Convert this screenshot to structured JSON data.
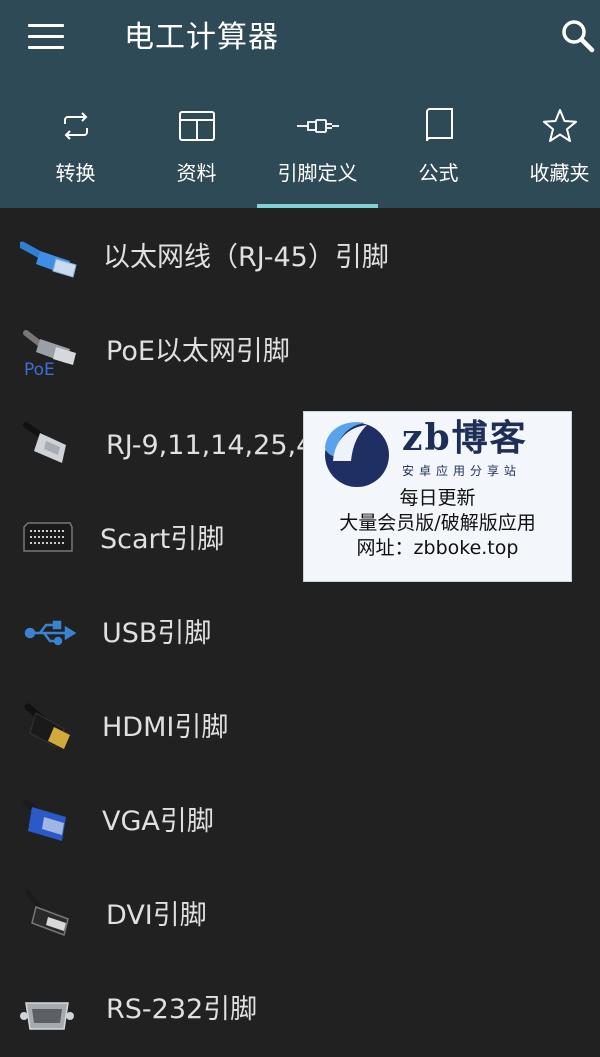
{
  "appbar": {
    "title": "电工计算器",
    "menu_icon": "hamburger-menu-icon",
    "search_icon": "search-icon"
  },
  "tabs": [
    {
      "label": "转换",
      "icon": "swap-arrows-icon"
    },
    {
      "label": "资料",
      "icon": "table-icon"
    },
    {
      "label": "引脚定义",
      "icon": "connector-cable-icon",
      "selected": true
    },
    {
      "label": "公式",
      "icon": "book-icon"
    },
    {
      "label": "收藏夹",
      "icon": "star-icon"
    }
  ],
  "list": {
    "items": [
      {
        "label": "以太网线（RJ-45）引脚",
        "icon": "rj45-cable-icon"
      },
      {
        "label": "PoE以太网引脚",
        "icon": "poe-cable-icon",
        "icon_text": "PoE"
      },
      {
        "label": "RJ-9,11,14,25,4",
        "icon": "rj11-cable-icon"
      },
      {
        "label": "Scart引脚",
        "icon": "scart-connector-icon"
      },
      {
        "label": "USB引脚",
        "icon": "usb-icon"
      },
      {
        "label": "HDMI引脚",
        "icon": "hdmi-cable-icon"
      },
      {
        "label": "VGA引脚",
        "icon": "vga-cable-icon"
      },
      {
        "label": "DVI引脚",
        "icon": "dvi-cable-icon"
      },
      {
        "label": "RS-232引脚",
        "icon": "rs232-connector-icon"
      }
    ]
  },
  "watermark": {
    "brand": "zb博客",
    "subtitle": "安卓应用分享站",
    "line1": "每日更新",
    "line2": "大量会员版/破解版应用",
    "line3": "网址：zbboke.top"
  },
  "colors": {
    "appbar": "#2f4a57",
    "background": "#212121",
    "indicator": "#7fd3d6",
    "text": "#e0e0e0"
  }
}
